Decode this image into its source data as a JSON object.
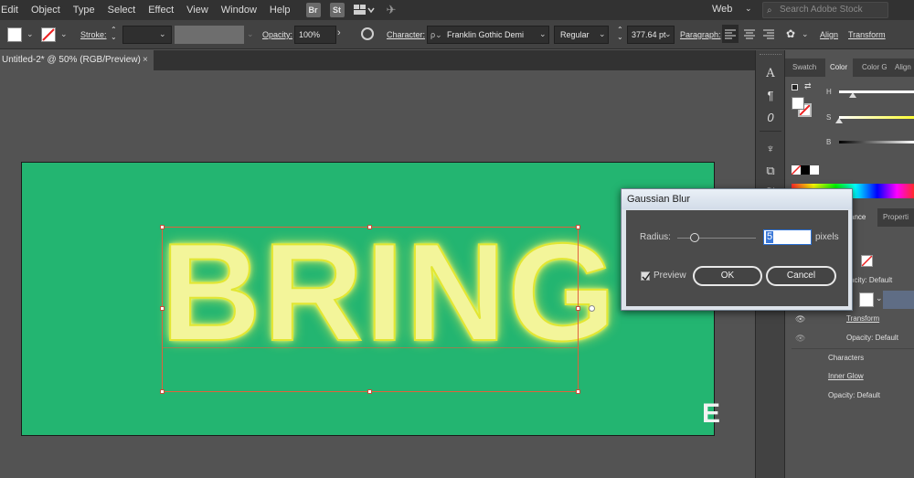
{
  "menu": [
    "Edit",
    "Object",
    "Type",
    "Select",
    "Effect",
    "View",
    "Window",
    "Help"
  ],
  "app_badges": [
    "Br",
    "St"
  ],
  "workspace": "Web",
  "search": {
    "placeholder": "Search Adobe Stock"
  },
  "control_bar": {
    "stroke_label": "Stroke:",
    "opacity_label": "Opacity:",
    "opacity_value": "100%",
    "character_label": "Character:",
    "font_family": "Franklin Gothic Demi",
    "font_style": "Regular",
    "font_size": "377.64 pt",
    "paragraph_label": "Paragraph:",
    "align_label": "Align",
    "transform_label": "Transform"
  },
  "document_tab": {
    "title": "Untitled-2* @ 50% (RGB/Preview)",
    "close": "×"
  },
  "artboard": {
    "text": "BRING",
    "background_color": "#23b571",
    "text_color": "#f3f59a"
  },
  "color_panel": {
    "tabs": [
      "Swatch",
      "Color",
      "Color G",
      "Align"
    ],
    "active_tab": "Color",
    "h_label": "H",
    "s_label": "S",
    "b_label": "B"
  },
  "appearance_panel": {
    "tabs": [
      "ance",
      "Properti"
    ],
    "rows": [
      "acity: Default",
      "Transform",
      "Opacity: Default",
      "Characters",
      "Inner Glow",
      "Opacity: Default"
    ]
  },
  "dialog": {
    "title": "Gaussian Blur",
    "radius_label": "Radius:",
    "radius_value": "5",
    "unit": "pixels",
    "preview_label": "Preview",
    "preview_checked": true,
    "ok_label": "OK",
    "cancel_label": "Cancel"
  },
  "watermark_letter": "E"
}
